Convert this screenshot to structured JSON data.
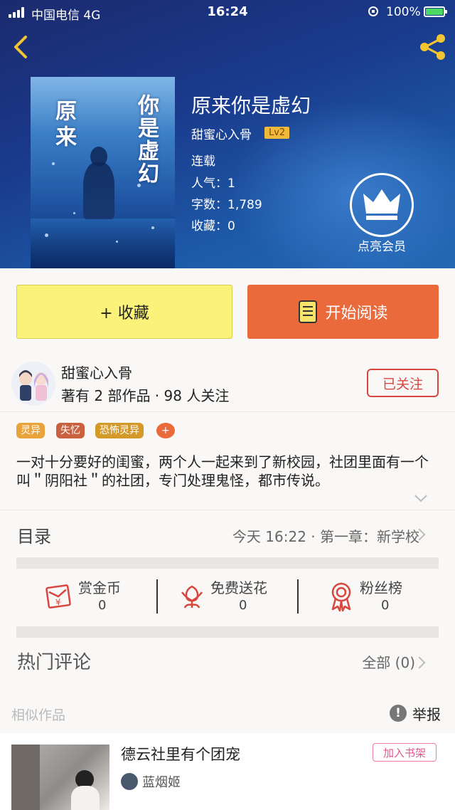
{
  "status_bar": {
    "carrier": "中国电信  4G",
    "time": "16:24",
    "battery": "100%"
  },
  "book": {
    "title": "原来你是虚幻",
    "cover_title_1": "原来",
    "cover_title_2": "你是虚幻",
    "author": "甜蜜心入骨",
    "level": "Lv2",
    "status": "连载",
    "popularity": "人气：1",
    "word_count": "字数：1,789",
    "favorites": "收藏：0",
    "member_label": "点亮会员"
  },
  "actions": {
    "collect": "+ 收藏",
    "read": "开始阅读"
  },
  "author_info": {
    "name": "甜蜜心入骨",
    "meta": "著有 2 部作品 · 98 人关注",
    "follow": "已关注"
  },
  "tags": [
    {
      "label": "灵异",
      "color": "#eaa33a"
    },
    {
      "label": "失忆",
      "color": "#c9613e"
    },
    {
      "label": "恐怖灵异",
      "color": "#d39a2a"
    },
    {
      "label": "+",
      "color": "#ea6a3c"
    }
  ],
  "synopsis": "一对十分要好的闺蜜，两个人一起来到了新校园，社团里面有一个叫＂阴阳社＂的社团，专门处理鬼怪，都市传说。",
  "toc": {
    "title": "目录",
    "latest": "今天 16:22 · 第一章：新学校"
  },
  "stats": [
    {
      "label": "赏金币",
      "value": "0"
    },
    {
      "label": "免费送花",
      "value": "0"
    },
    {
      "label": "粉丝榜",
      "value": "0"
    }
  ],
  "comments": {
    "title": "热门评论",
    "all": "全部 (0)"
  },
  "similar": {
    "title": "相似作品",
    "report": "举报"
  },
  "similar_book": {
    "title": "德云社里有个团宠",
    "author": "蓝烟姬",
    "add": "加入书架"
  },
  "colors": {
    "accent": "#ea6a3c",
    "collect_bg": "#fbf27a",
    "follow": "#d9453f",
    "add_shelf": "#e0588e"
  }
}
